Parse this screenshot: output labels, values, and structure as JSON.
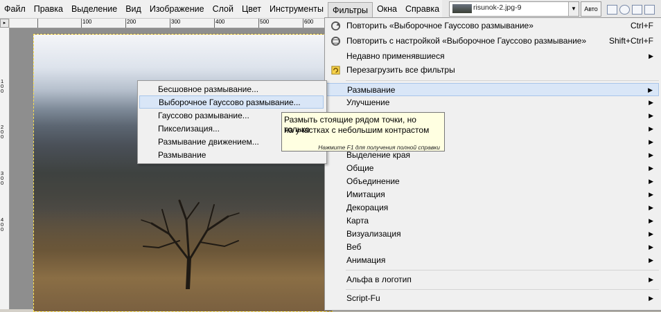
{
  "menubar": {
    "items": [
      "Файл",
      "Правка",
      "Выделение",
      "Вид",
      "Изображение",
      "Слой",
      "Цвет",
      "Инструменты",
      "Фильтры",
      "Окна",
      "Справка"
    ],
    "open_index": 8
  },
  "image_combo": {
    "name": "risunok-2.jpg-9"
  },
  "auto_button": "Авто",
  "ruler": {
    "h_labels": [
      "100",
      "200",
      "300",
      "400",
      "500",
      "600"
    ],
    "v_labels": [
      "1 0 0",
      "2 0 0",
      "3 0 0",
      "4 0 0"
    ]
  },
  "filters_menu": {
    "items": [
      {
        "label": "Повторить «Выборочное Гауссово размывание»",
        "shortcut": "Ctrl+F",
        "icon": "repeat-icon"
      },
      {
        "label": "Повторить с настройкой «Выборочное Гауссово размывание»",
        "shortcut": "Shift+Ctrl+F",
        "icon": "reshow-icon"
      },
      {
        "label": "Недавно применявшиеся",
        "submenu": true
      },
      {
        "label": "Перезагрузить все фильтры",
        "icon": "reload-icon"
      },
      {
        "label": "Размывание",
        "submenu": true,
        "highlight": true
      },
      {
        "label": "Улучшение",
        "submenu": true
      },
      {
        "label": "Выделение края",
        "submenu": true
      },
      {
        "label": "Общие",
        "submenu": true
      },
      {
        "label": "Объединение",
        "submenu": true
      },
      {
        "label": "Имитация",
        "submenu": true
      },
      {
        "label": "Декорация",
        "submenu": true
      },
      {
        "label": "Карта",
        "submenu": true
      },
      {
        "label": "Визуализация",
        "submenu": true
      },
      {
        "label": "Веб",
        "submenu": true
      },
      {
        "label": "Анимация",
        "submenu": true
      },
      {
        "label": "Альфа в логотип",
        "submenu": true
      },
      {
        "label": "Script-Fu",
        "submenu": true
      }
    ],
    "hidden_arrow_count": 3
  },
  "blur_submenu": {
    "items": [
      {
        "label": "Бесшовное размывание..."
      },
      {
        "label": "Выборочное Гауссово размывание...",
        "highlight": true
      },
      {
        "label": "Гауссово размывание..."
      },
      {
        "label": "Пикселизация..."
      },
      {
        "label": "Размывание движением..."
      },
      {
        "label": "Размывание"
      }
    ]
  },
  "tooltip": {
    "line1": "Размыть стоящие рядом точки, но только",
    "line2": "на участках с небольшим контрастом",
    "hint": "Нажмите F1 для получения полной справки"
  },
  "colors": {
    "menu_bg": "#f0f0f0",
    "highlight_bg": "#d9e6f7",
    "tooltip_bg": "#ffffe1",
    "selection_border": "#ffe34d"
  }
}
